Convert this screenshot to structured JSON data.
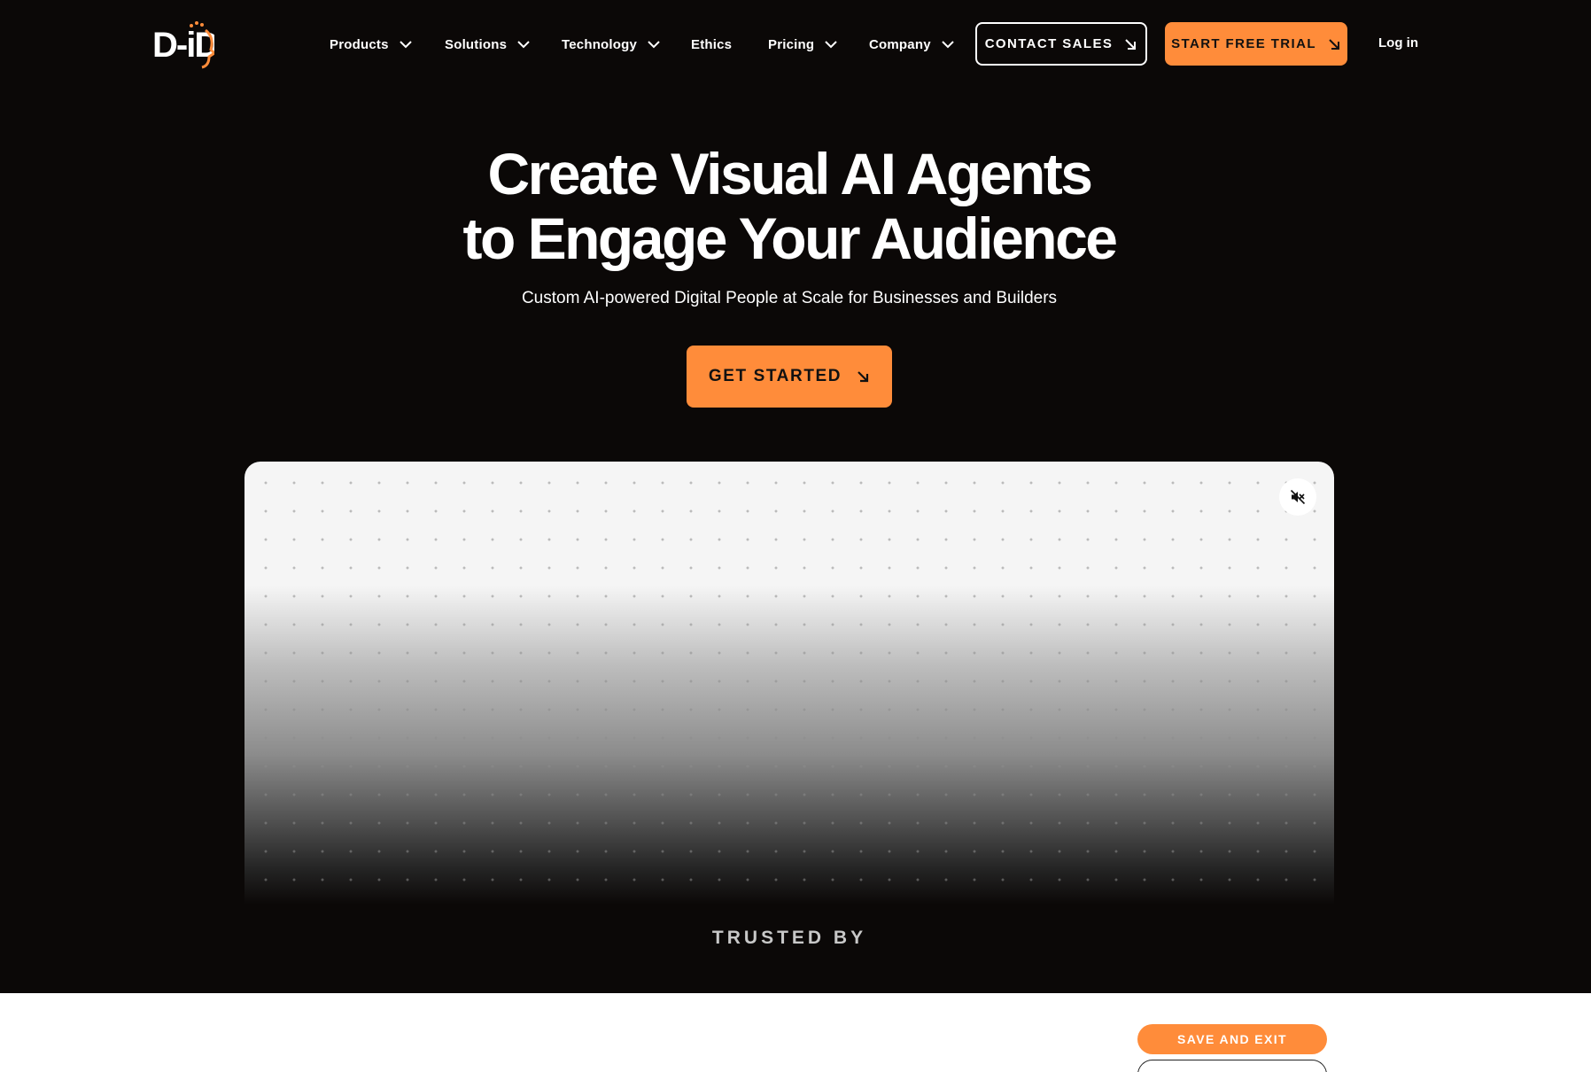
{
  "brand": {
    "logo_text": "D-iD",
    "accent": "#ff8c3a",
    "background": "#0b0807"
  },
  "nav": {
    "items": [
      {
        "label": "Products",
        "has_dropdown": true
      },
      {
        "label": "Solutions",
        "has_dropdown": true
      },
      {
        "label": "Technology",
        "has_dropdown": true
      },
      {
        "label": "Ethics",
        "has_dropdown": false
      },
      {
        "label": "Pricing",
        "has_dropdown": true
      },
      {
        "label": "Company",
        "has_dropdown": true
      }
    ],
    "contact_sales": "CONTACT SALES",
    "start_trial": "START FREE TRIAL",
    "login": "Log in"
  },
  "hero": {
    "title_line1": "Create Visual AI Agents",
    "title_line2": "to Engage Your Audience",
    "subtitle": "Custom AI-powered Digital People at Scale for Businesses and Builders",
    "cta": "GET STARTED"
  },
  "video": {
    "mute_icon": "speaker-muted-icon"
  },
  "trusted": {
    "label": "TRUSTED BY"
  },
  "floating": {
    "save_exit": "SAVE AND EXIT"
  }
}
